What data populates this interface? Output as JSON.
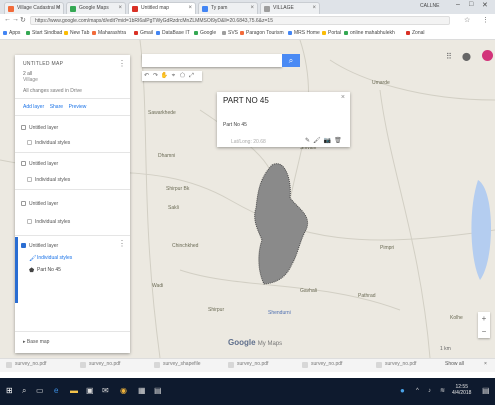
{
  "browser": {
    "tabs": [
      {
        "label": "Village Cadastral M",
        "color": "#f26b3a",
        "active": false
      },
      {
        "label": "Google Maps",
        "color": "#34a853",
        "active": false
      },
      {
        "label": "Untitled map",
        "color": "#d93025",
        "active": true
      },
      {
        "label": "Ty pam",
        "color": "#4285f4",
        "active": false
      },
      {
        "label": "VILLAGE",
        "color": "#9e9e9e",
        "active": false
      }
    ],
    "window_user": "CALLNE",
    "url": "https://www.google.com/maps/d/edit?mid=1bRI6aIPgTWyGdRzdrcMnZLMMSOI9yD&ll=20.6843,75.6&z=15",
    "bookmarks": [
      {
        "label": "Apps",
        "color": "#4285f4"
      },
      {
        "label": "Start Sindbad",
        "color": "#34a853"
      },
      {
        "label": "New Tab",
        "color": "#fbbc05"
      },
      {
        "label": "Maharashtra",
        "color": "#f26b3a"
      },
      {
        "label": "Gmail",
        "color": "#d93025"
      },
      {
        "label": "DataBase IT",
        "color": "#4285f4"
      },
      {
        "label": "Google",
        "color": "#34a853"
      },
      {
        "label": "SVS",
        "color": "#9e9e9e"
      },
      {
        "label": "Paragon Tourism",
        "color": "#f26b3a"
      },
      {
        "label": "MRS Home",
        "color": "#4285f4"
      },
      {
        "label": "Portal",
        "color": "#fbbc05"
      },
      {
        "label": "online mahabhulekh",
        "color": "#34a853"
      },
      {
        "label": "Zonal",
        "color": "#d93025"
      }
    ]
  },
  "map_panel": {
    "title": "UNTITLED MAP",
    "subtitle_1": "2 all",
    "subtitle_2": "Village",
    "last_edit": "All changes saved in Drive",
    "add_layer": "Add layer",
    "share": "Share",
    "preview": "Preview",
    "layers": [
      {
        "label": "Untitled layer",
        "checked": false,
        "sub": false
      },
      {
        "label": "Individual styles",
        "checked": false,
        "sub": true
      },
      {
        "label": "Untitled layer",
        "checked": false,
        "sub": false
      },
      {
        "label": "Individual styles",
        "checked": false,
        "sub": true
      },
      {
        "label": "Untitled layer",
        "checked": false,
        "sub": false
      },
      {
        "label": "Individual styles",
        "checked": false,
        "sub": true
      }
    ],
    "active_layer": "Untitled layer",
    "active_styles": "Individual styles",
    "active_item": "Part No 45",
    "base_map": "Base map"
  },
  "search": {
    "placeholder": ""
  },
  "toolbar": {
    "tools": [
      "↶",
      "↷",
      "✋",
      "⌖",
      "⬠",
      "⤢",
      "▭"
    ]
  },
  "popup": {
    "title": "PART NO 45",
    "body": "Part No 45",
    "coords": "Lat/Long: 20.68",
    "tools": [
      "✎",
      "🖌",
      "📷",
      "🗑"
    ]
  },
  "map_labels": [
    {
      "text": "Umarde",
      "color": "#6b6b55"
    },
    {
      "text": "Sawarkhede",
      "color": "#6b6b55"
    },
    {
      "text": "Dhamni",
      "color": "#6b6b55"
    },
    {
      "text": "Shirpur Bk",
      "color": "#6b6b55"
    },
    {
      "text": "Shivani",
      "color": "#6b6b55"
    },
    {
      "text": "Sakli",
      "color": "#6b6b55"
    },
    {
      "text": "Chinchkhed",
      "color": "#6b6b55"
    },
    {
      "text": "Pimpri",
      "color": "#6b6b55"
    },
    {
      "text": "Wadi",
      "color": "#6b6b55"
    },
    {
      "text": "Gavhali",
      "color": "#6b6b55"
    },
    {
      "text": "Pathrad",
      "color": "#6b6b55"
    },
    {
      "text": "Shirpur",
      "color": "#6b6b55"
    },
    {
      "text": "Shendurni",
      "color": "#4e6fb0"
    },
    {
      "text": "Kolhe",
      "color": "#6b6b55"
    }
  ],
  "logo": {
    "brand": "Google",
    "product": "My Maps"
  },
  "scale_label": "1 km",
  "downloads": [
    {
      "label": "survey_no.pdf"
    },
    {
      "label": "survey_no.pdf"
    },
    {
      "label": "survey_shapefile"
    },
    {
      "label": "survey_no.pdf"
    },
    {
      "label": "survey_no.pdf"
    },
    {
      "label": "survey_no.pdf"
    }
  ],
  "downloads_show_all": "Show all",
  "taskbar": {
    "time": "12:55",
    "date": "4/4/2018"
  },
  "colors": {
    "accent": "#4a8af4",
    "polygon": "#8a8a8a",
    "taskbar": "#0e1a2e",
    "avatar": "#d2337a"
  }
}
